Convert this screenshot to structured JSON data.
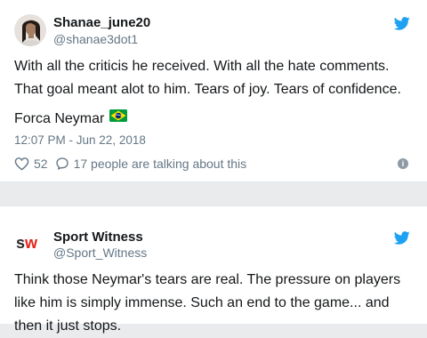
{
  "tweets": [
    {
      "display_name": "Shanae_june20",
      "handle": "@shanae3dot1",
      "text": "With all the criticis he received. With all the hate comments. That goal meant alot to him. Tears of joy. Tears of confidence.",
      "signoff": "Forca Neymar",
      "flag_icon": "brazil-flag-icon",
      "timestamp": "12:07 PM - Jun 22, 2018",
      "likes": "52",
      "replies": "17 people are talking about this"
    },
    {
      "display_name": "Sport Witness",
      "handle": "@Sport_Witness",
      "avatar_text": "sw",
      "text": "Think those Neymar's tears are real. The pressure on players like him is simply immense. Such an end to the game... and then it just stops."
    }
  ],
  "colors": {
    "twitter_blue": "#1da1f2",
    "sw_red": "#e2231a",
    "gray_text": "#657786"
  },
  "icons": [
    "twitter-bird-icon",
    "heart-icon",
    "comment-icon",
    "info-icon"
  ]
}
